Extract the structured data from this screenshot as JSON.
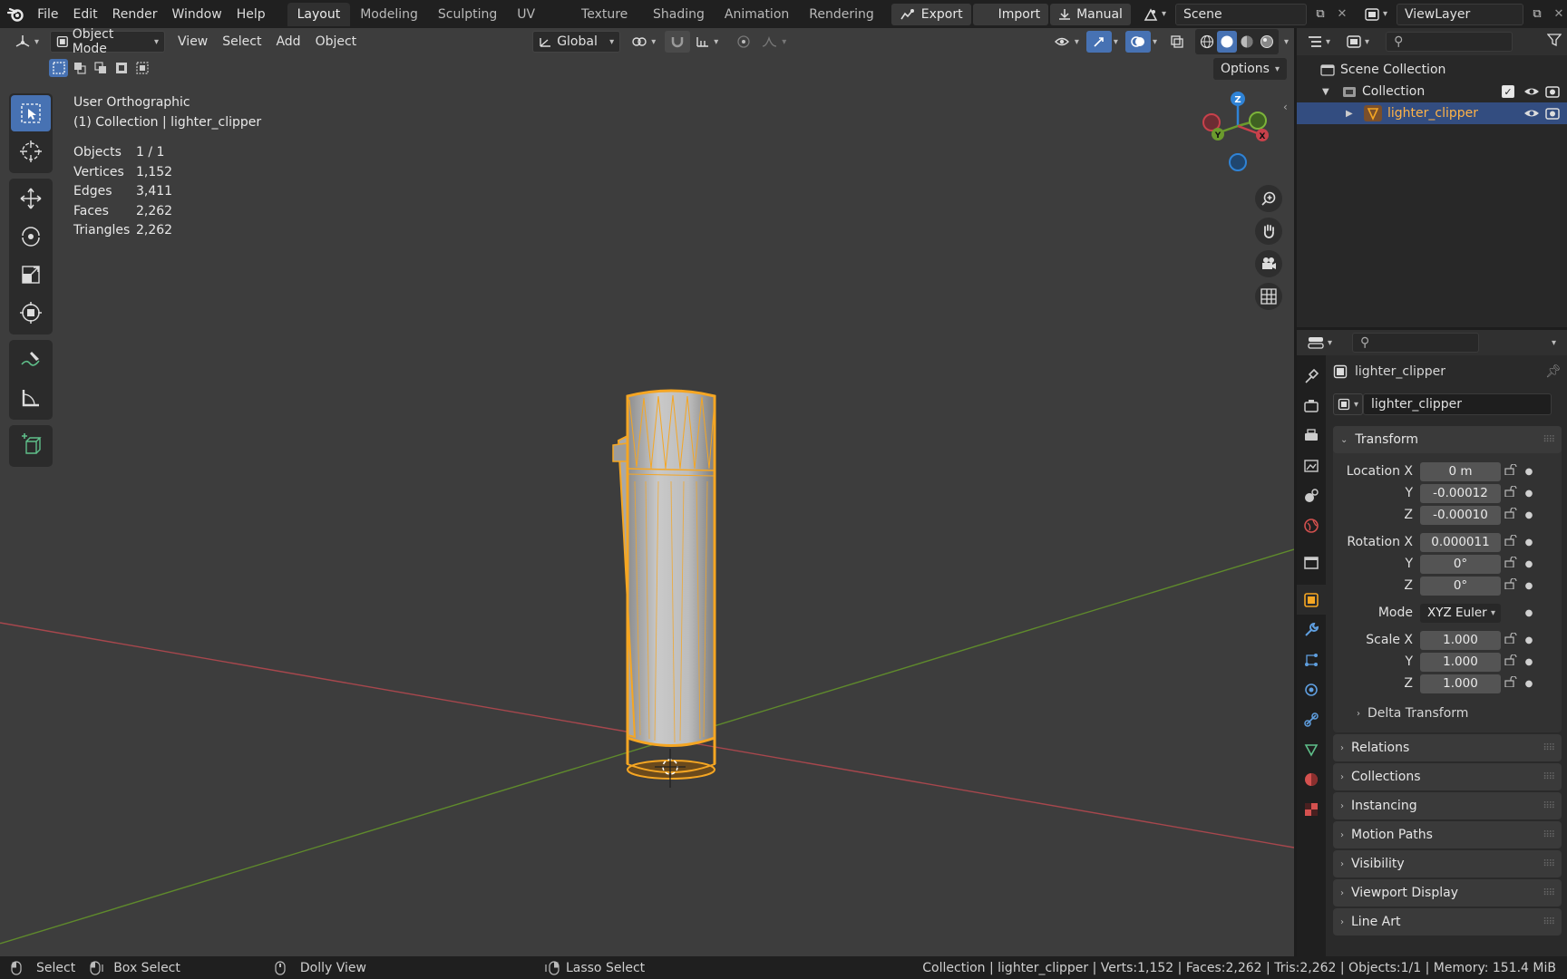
{
  "app": {
    "menus": [
      "File",
      "Edit",
      "Render",
      "Window",
      "Help"
    ],
    "workspaces": [
      "Layout",
      "Modeling",
      "Sculpting",
      "UV Editing",
      "Texture Paint",
      "Shading",
      "Animation",
      "Rendering"
    ],
    "active_workspace": "Layout",
    "export_label": "Export",
    "import_label": "Import",
    "manual_label": "Manual",
    "scene_name": "Scene",
    "view_layer": "ViewLayer"
  },
  "viewport_header": {
    "mode": "Object Mode",
    "menus": [
      "View",
      "Select",
      "Add",
      "Object"
    ],
    "orientation": "Global",
    "options_label": "Options"
  },
  "viewport_info": {
    "view_name": "User Orthographic",
    "collection_line": "(1) Collection | lighter_clipper",
    "stats": [
      {
        "label": "Objects",
        "value": "1 / 1"
      },
      {
        "label": "Vertices",
        "value": "1,152"
      },
      {
        "label": "Edges",
        "value": "3,411"
      },
      {
        "label": "Faces",
        "value": "2,262"
      },
      {
        "label": "Triangles",
        "value": "2,262"
      }
    ]
  },
  "gizmo": {
    "z": "Z",
    "y": "Y",
    "x": "X"
  },
  "outliner": {
    "scene_collection": "Scene Collection",
    "collection": "Collection",
    "object": "lighter_clipper"
  },
  "properties": {
    "object_name": "lighter_clipper",
    "datablock_name": "lighter_clipper",
    "transform_title": "Transform",
    "location_label": "Location X",
    "rotation_label": "Rotation X",
    "scale_label": "Scale X",
    "y_label": "Y",
    "z_label": "Z",
    "mode_label": "Mode",
    "location": [
      "0 m",
      "-0.00012",
      "-0.00010"
    ],
    "rotation": [
      "0.000011",
      "0°",
      "0°"
    ],
    "rotation_mode": "XYZ Euler",
    "scale": [
      "1.000",
      "1.000",
      "1.000"
    ],
    "delta_transform": "Delta Transform",
    "panels": [
      "Relations",
      "Collections",
      "Instancing",
      "Motion Paths",
      "Visibility",
      "Viewport Display",
      "Line Art"
    ]
  },
  "statusbar": {
    "select": "Select",
    "box_select": "Box Select",
    "dolly": "Dolly View",
    "lasso": "Lasso Select",
    "info": "Collection | lighter_clipper | Verts:1,152 | Faces:2,262 | Tris:2,262 | Objects:1/1 | Memory: 151.4 MiB"
  },
  "colors": {
    "selection_orange": "#f5a623",
    "active_blue": "#4772b3",
    "axis_x_red": "#c8414b",
    "axis_y_green": "#6b9a2d",
    "gizmo_z_blue": "#2f83d6"
  }
}
